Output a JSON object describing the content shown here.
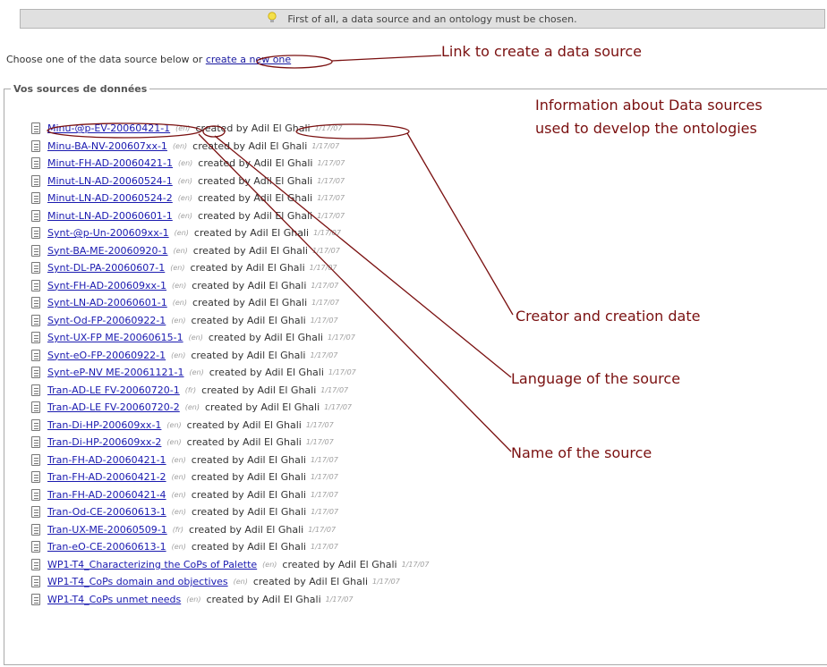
{
  "banner": {
    "icon": "lightbulb-icon",
    "text": "First of all, a data source and an ontology must be chosen."
  },
  "intro": {
    "text": "Choose one of the data source below  or ",
    "link": "create a new one"
  },
  "legend": "Vos sources de données",
  "created_label": "created by",
  "sources": [
    {
      "name": "Minu-@p-EV-20060421-1",
      "lang": "(en)",
      "author": "Adil El Ghali",
      "date": "1/17/07"
    },
    {
      "name": "Minu-BA-NV-200607xx-1",
      "lang": "(en)",
      "author": "Adil El Ghali",
      "date": "1/17/07"
    },
    {
      "name": "Minut-FH-AD-20060421-1",
      "lang": "(en)",
      "author": "Adil El Ghali",
      "date": "1/17/07"
    },
    {
      "name": "Minut-LN-AD-20060524-1",
      "lang": "(en)",
      "author": "Adil El Ghali",
      "date": "1/17/07"
    },
    {
      "name": "Minut-LN-AD-20060524-2",
      "lang": "(en)",
      "author": "Adil El Ghali",
      "date": "1/17/07"
    },
    {
      "name": "Minut-LN-AD-20060601-1",
      "lang": "(en)",
      "author": "Adil El Ghali",
      "date": "1/17/07"
    },
    {
      "name": "Synt-@p-Un-200609xx-1",
      "lang": "(en)",
      "author": "Adil El Ghali",
      "date": "1/17/07"
    },
    {
      "name": "Synt-BA-ME-20060920-1",
      "lang": "(en)",
      "author": "Adil El Ghali",
      "date": "1/17/07"
    },
    {
      "name": "Synt-DL-PA-20060607-1",
      "lang": "(en)",
      "author": "Adil El Ghali",
      "date": "1/17/07"
    },
    {
      "name": "Synt-FH-AD-200609xx-1",
      "lang": "(en)",
      "author": "Adil El Ghali",
      "date": "1/17/07"
    },
    {
      "name": "Synt-LN-AD-20060601-1",
      "lang": "(en)",
      "author": "Adil El Ghali",
      "date": "1/17/07"
    },
    {
      "name": "Synt-Od-FP-20060922-1",
      "lang": "(en)",
      "author": "Adil El Ghali",
      "date": "1/17/07"
    },
    {
      "name": "Synt-UX-FP ME-20060615-1",
      "lang": "(en)",
      "author": "Adil El Ghali",
      "date": "1/17/07"
    },
    {
      "name": "Synt-eO-FP-20060922-1",
      "lang": "(en)",
      "author": "Adil El Ghali",
      "date": "1/17/07"
    },
    {
      "name": "Synt-eP-NV ME-20061121-1",
      "lang": "(en)",
      "author": "Adil El Ghali",
      "date": "1/17/07"
    },
    {
      "name": "Tran-AD-LE FV-20060720-1",
      "lang": "(fr)",
      "author": "Adil El Ghali",
      "date": "1/17/07"
    },
    {
      "name": "Tran-AD-LE FV-20060720-2",
      "lang": "(en)",
      "author": "Adil El Ghali",
      "date": "1/17/07"
    },
    {
      "name": "Tran-Di-HP-200609xx-1",
      "lang": "(en)",
      "author": "Adil El Ghali",
      "date": "1/17/07"
    },
    {
      "name": "Tran-Di-HP-200609xx-2",
      "lang": "(en)",
      "author": "Adil El Ghali",
      "date": "1/17/07"
    },
    {
      "name": "Tran-FH-AD-20060421-1",
      "lang": "(en)",
      "author": "Adil El Ghali",
      "date": "1/17/07"
    },
    {
      "name": "Tran-FH-AD-20060421-2",
      "lang": "(en)",
      "author": "Adil El Ghali",
      "date": "1/17/07"
    },
    {
      "name": "Tran-FH-AD-20060421-4",
      "lang": "(en)",
      "author": "Adil El Ghali",
      "date": "1/17/07"
    },
    {
      "name": "Tran-Od-CE-20060613-1",
      "lang": "(en)",
      "author": "Adil El Ghali",
      "date": "1/17/07"
    },
    {
      "name": "Tran-UX-ME-20060509-1",
      "lang": "(fr)",
      "author": "Adil El Ghali",
      "date": "1/17/07"
    },
    {
      "name": "Tran-eO-CE-20060613-1",
      "lang": "(en)",
      "author": "Adil El Ghali",
      "date": "1/17/07"
    },
    {
      "name": "WP1-T4_Characterizing the CoPs of Palette",
      "lang": "(en)",
      "author": "Adil El Ghali",
      "date": "1/17/07"
    },
    {
      "name": "WP1-T4_CoPs domain and objectives",
      "lang": "(en)",
      "author": "Adil El Ghali",
      "date": "1/17/07"
    },
    {
      "name": "WP1-T4_CoPs unmet needs",
      "lang": "(en)",
      "author": "Adil El Ghali",
      "date": "1/17/07"
    }
  ],
  "annotations": {
    "link": "Link to create a data source",
    "info_line1": "Information about Data sources",
    "info_line2": "used to develop the ontologies",
    "creator": "Creator and creation date",
    "language": "Language of the source",
    "name": "Name of the source"
  },
  "colors": {
    "annotation": "#7a1010",
    "link": "#1a1ab0"
  }
}
